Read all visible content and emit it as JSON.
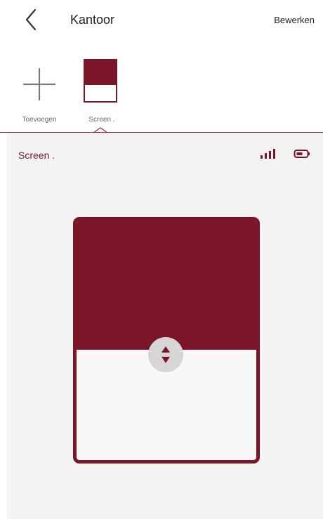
{
  "header": {
    "title": "Kantoor",
    "edit_label": "Bewerken"
  },
  "devices": [
    {
      "label": "Toevoegen",
      "icon": "plus-icon"
    },
    {
      "label": "Screen .",
      "icon": "screen-shade-icon",
      "selected": true,
      "position_percent": 60
    }
  ],
  "panel": {
    "title": "Screen .",
    "signal_icon": "signal-bars-icon",
    "battery_icon": "battery-icon",
    "shade_position_percent": 54,
    "accent_color": "#7a1628"
  }
}
